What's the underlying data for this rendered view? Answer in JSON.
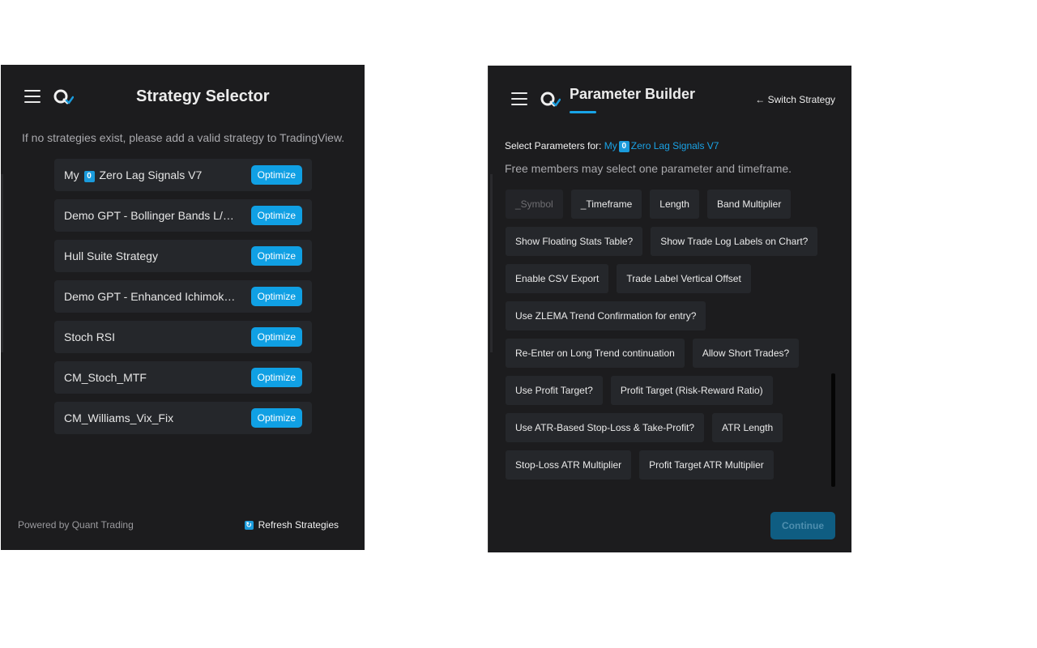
{
  "left": {
    "title": "Strategy Selector",
    "notice": "If no strategies exist, please add a valid strategy to TradingView.",
    "strategies": [
      {
        "name_prefix": "My",
        "badge": "0",
        "name_suffix": "Zero Lag Signals V7",
        "button": "Optimize"
      },
      {
        "name": "Demo GPT - Bollinger Bands L/S Strategy",
        "button": "Optimize"
      },
      {
        "name": "Hull Suite Strategy",
        "button": "Optimize"
      },
      {
        "name": "Demo GPT - Enhanced Ichimoku Strategy",
        "button": "Optimize"
      },
      {
        "name": "Stoch RSI",
        "button": "Optimize"
      },
      {
        "name": "CM_Stoch_MTF",
        "button": "Optimize"
      },
      {
        "name": "CM_Williams_Vix_Fix",
        "button": "Optimize"
      }
    ],
    "footer": "Powered by Quant Trading",
    "refresh_label": "Refresh Strategies"
  },
  "right": {
    "title": "Parameter Builder",
    "switch_label": "← Switch Strategy",
    "select_prefix": "Select Parameters for:",
    "strategy_prefix": "My",
    "strategy_badge": "0",
    "strategy_suffix": "Zero Lag Signals V7",
    "free_note": "Free members may select one parameter and timeframe.",
    "param_rows": [
      [
        "_Symbol",
        "_Timeframe",
        "Length",
        "Band Multiplier"
      ],
      [
        "Show Floating Stats Table?",
        "Show Trade Log Labels on Chart?"
      ],
      [
        "Enable CSV Export",
        "Trade Label Vertical Offset"
      ],
      [
        "Use ZLEMA Trend Confirmation for entry?"
      ],
      [
        "Re-Enter on Long Trend continuation",
        "Allow Short Trades?"
      ],
      [
        "Use Profit Target?",
        "Profit Target (Risk-Reward Ratio)"
      ],
      [
        "Use ATR-Based Stop-Loss & Take-Profit?",
        "ATR Length"
      ],
      [
        "Stop-Loss ATR Multiplier",
        "Profit Target ATR Multiplier"
      ]
    ],
    "disabled_params": [
      "_Symbol"
    ],
    "continue_label": "Continue"
  },
  "colors": {
    "accent": "#10a0e4",
    "panel_bg": "#1c1c1e",
    "chip_bg": "#25272b"
  },
  "icons": {
    "menu": "hamburger-icon",
    "logo": "quant-logo-icon",
    "refresh": "refresh-icon"
  }
}
